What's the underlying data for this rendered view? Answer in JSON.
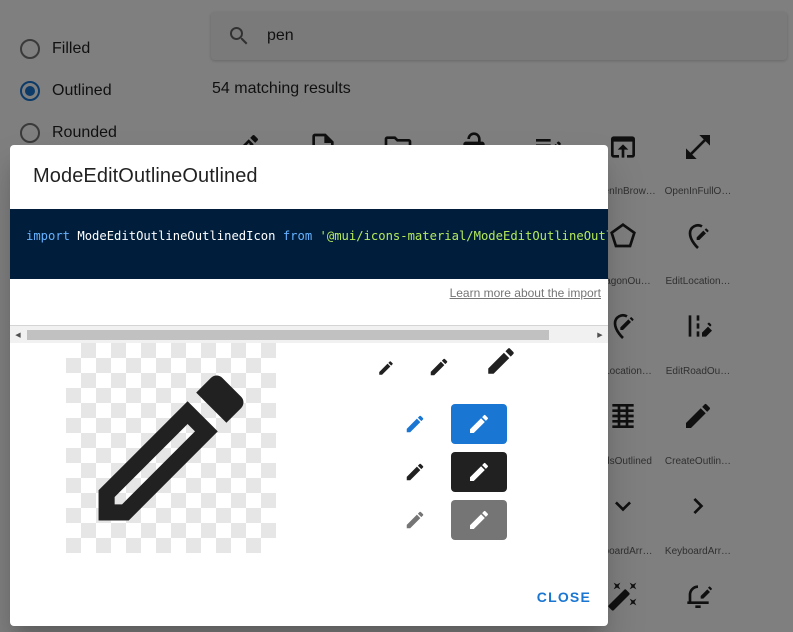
{
  "sidebar": {
    "options": [
      {
        "label": "Filled",
        "checked": false
      },
      {
        "label": "Outlined",
        "checked": true
      },
      {
        "label": "Rounded",
        "checked": false
      }
    ]
  },
  "search": {
    "value": "pen",
    "icon": "search-icon"
  },
  "results": {
    "count_text": "54 matching results"
  },
  "grid": {
    "labels": {
      "open_in_browser": "OpenInBrow…",
      "open_in_full": "OpenInFullO…",
      "pentagon": "…agonOu…",
      "edit_location": "EditLocation…",
      "edit_location_alt": "…Location…",
      "edit_road": "EditRoadOu…",
      "edit_attributes": "…dsOutlined",
      "create": "CreateOutlin…",
      "keyboard_arrow_down": "…boardArr…",
      "keyboard_arrow_right": "KeyboardArr…"
    }
  },
  "dialog": {
    "title": "ModeEditOutlineOutlined",
    "code": {
      "import_kw": "import",
      "component": "ModeEditOutlineOutlinedIcon",
      "from_kw": "from",
      "path": "'@mui/icons-material/ModeEditOutlineOutlined'"
    },
    "learn_more": "Learn more about the import",
    "close_label": "CLOSE"
  },
  "colors": {
    "primary": "#1976d2",
    "dark": "#212121",
    "grey": "#757575",
    "code_bg": "#001e3c"
  }
}
